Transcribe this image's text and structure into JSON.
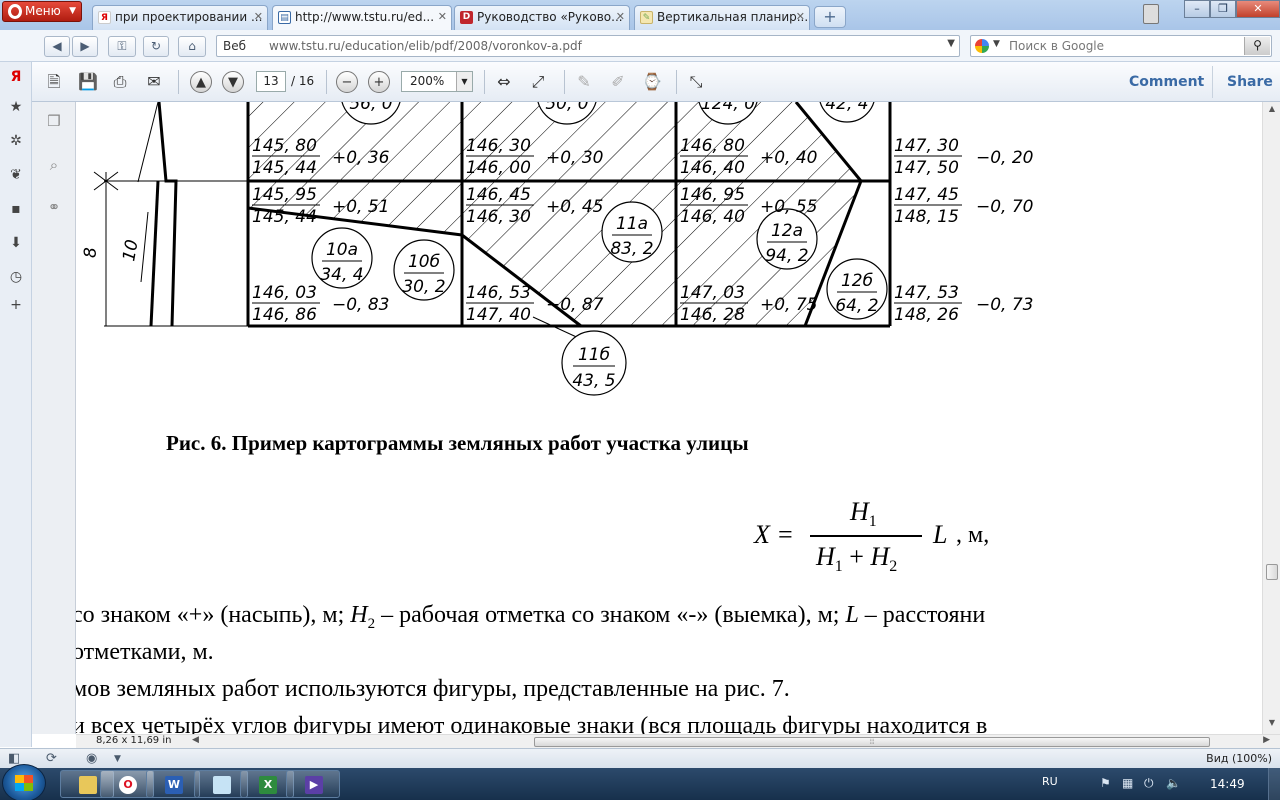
{
  "browser": {
    "menu_label": "Меню",
    "tabs": [
      {
        "title": "при проектировании ...",
        "favicon": "yandex-icon",
        "active": false
      },
      {
        "title": "http://www.tstu.ru/ed...",
        "favicon": "document-icon",
        "active": true
      },
      {
        "title": "Руководство «Руково...",
        "favicon": "site-icon",
        "active": false
      },
      {
        "title": "Вертикальная планир...",
        "favicon": "page-icon",
        "active": false
      }
    ],
    "address_label": "Веб",
    "url": "www.tstu.ru/education/elib/pdf/2008/voronkov-a.pdf",
    "search_placeholder": "Поиск в Google"
  },
  "pdf_toolbar": {
    "page_current": "13",
    "page_total": "/ 16",
    "zoom": "200%",
    "comment_label": "Comment",
    "share_label": "Share"
  },
  "document": {
    "caption": "Рис. 6. Пример картограммы земляных работ участка улицы",
    "formula": {
      "lhs": "X =",
      "num": "H",
      "num_sub": "1",
      "den_a": "H",
      "den_a_sub": "1",
      "plus": "+",
      "den_b": "H",
      "den_b_sub": "2",
      "rhs": "L",
      "unit": ", м,"
    },
    "text_lines": [
      {
        "a": "со знаком «+» (насыпь), м; ",
        "h": "H",
        "hs": "2",
        "b": " – рабочая отметка со знаком «-» (выемка), м; ",
        "l": "L",
        "c": " – расстояни"
      },
      {
        "a": " отметками, м."
      },
      {
        "a": "мов земляных работ используются фигуры, представленные на рис. 7."
      },
      {
        "a": "и всех четырёх углов фигуры имеют одинаковые знаки (вся площадь фигуры находится в"
      }
    ],
    "drawing": {
      "dimension": {
        "span": "8",
        "slope": "10"
      },
      "figures_top": [
        "56, 0",
        "50, 0",
        "124, 0",
        "42, 4"
      ],
      "figures": [
        {
          "id": "10а",
          "area": "34, 4"
        },
        {
          "id": "10б",
          "area": "30, 2"
        },
        {
          "id": "11а",
          "area": "83, 2"
        },
        {
          "id": "11б",
          "area": "43, 5"
        },
        {
          "id": "12а",
          "area": "94, 2"
        },
        {
          "id": "12б",
          "area": "64, 2"
        }
      ],
      "marks": [
        {
          "top": "145, 80",
          "bottom": "145, 44",
          "work": "+0, 36"
        },
        {
          "top": "146, 30",
          "bottom": "146, 00",
          "work": "+0, 30"
        },
        {
          "top": "146, 80",
          "bottom": "146, 40",
          "work": "+0, 40"
        },
        {
          "top": "147, 30",
          "bottom": "147, 50",
          "work": "−0, 20"
        },
        {
          "top": "145, 95",
          "bottom": "145, 44",
          "work": "+0, 51"
        },
        {
          "top": "146, 45",
          "bottom": "146, 30",
          "work": "+0, 45"
        },
        {
          "top": "146, 95",
          "bottom": "146, 40",
          "work": "+0, 55"
        },
        {
          "top": "147, 45",
          "bottom": "148, 15",
          "work": "−0, 70"
        },
        {
          "top": "146, 03",
          "bottom": "146, 86",
          "work": "−0, 83"
        },
        {
          "top": "146, 53",
          "bottom": "147, 40",
          "work": "−0, 87"
        },
        {
          "top": "147, 03",
          "bottom": "146, 28",
          "work": "+0, 75"
        },
        {
          "top": "147, 53",
          "bottom": "148, 26",
          "work": "−0, 73"
        }
      ]
    }
  },
  "status": {
    "page_size": "8,26 x 11,69 in",
    "zoom_view": "Вид (100%)"
  },
  "taskbar": {
    "lang": "RU",
    "clock": "14:49"
  }
}
